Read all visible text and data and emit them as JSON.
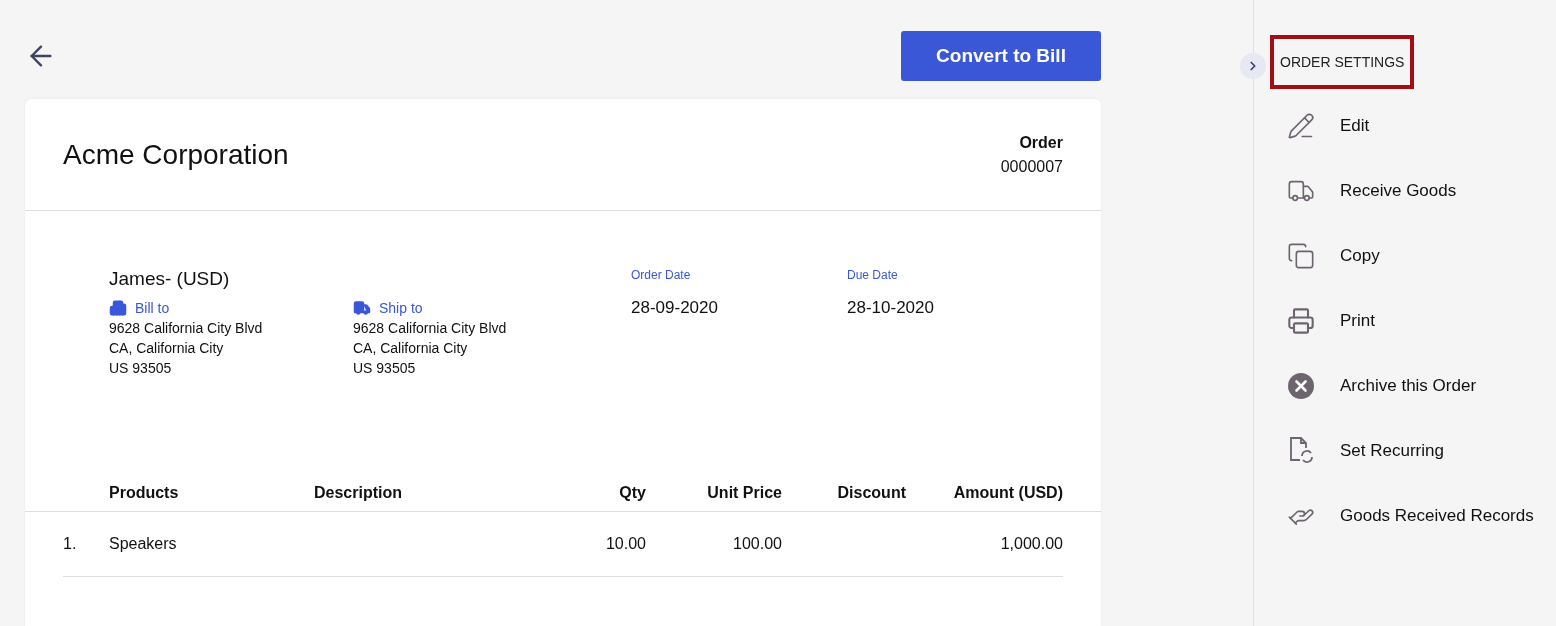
{
  "header": {
    "action_button": "Convert to Bill"
  },
  "document": {
    "company": "Acme Corporation",
    "type_label": "Order",
    "number": "0000007",
    "customer": "James- (USD)",
    "addresses": [
      {
        "kind": "bill",
        "label": "Bill to",
        "lines": [
          "9628 California City Blvd",
          "CA, California City",
          "US 93505"
        ]
      },
      {
        "kind": "ship",
        "label": "Ship to",
        "lines": [
          "9628 California City Blvd",
          "CA, California City",
          "US 93505"
        ]
      }
    ],
    "dates": [
      {
        "label": "Order Date",
        "value": "28-09-2020"
      },
      {
        "label": "Due Date",
        "value": "28-10-2020"
      }
    ],
    "table": {
      "columns": [
        "Products",
        "Description",
        "Qty",
        "Unit Price",
        "Discount",
        "Amount (USD)"
      ],
      "rows": [
        {
          "index": "1.",
          "cells": [
            "Speakers",
            "",
            "10.00",
            "100.00",
            "",
            "1,000.00"
          ]
        }
      ]
    }
  },
  "sidebar": {
    "title": "ORDER SETTINGS",
    "items": [
      {
        "kind": "edit",
        "label": "Edit"
      },
      {
        "kind": "truck",
        "label": "Receive Goods"
      },
      {
        "kind": "copy",
        "label": "Copy"
      },
      {
        "kind": "print",
        "label": "Print"
      },
      {
        "kind": "archive",
        "label": "Archive this Order"
      },
      {
        "kind": "recurring",
        "label": "Set Recurring"
      },
      {
        "kind": "records",
        "label": "Goods Received Records"
      }
    ]
  }
}
